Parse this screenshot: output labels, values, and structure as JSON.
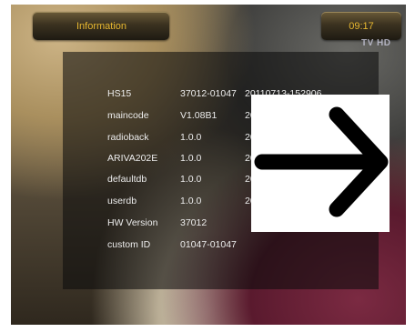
{
  "header": {
    "title": "Information",
    "time": "09:17",
    "channel_logo": "TV HD"
  },
  "info_table": {
    "rows": [
      {
        "name": "HS15",
        "version": "37012-01047",
        "date": "20110713-152906"
      },
      {
        "name": "maincode",
        "version": "V1.08B1",
        "date": "20"
      },
      {
        "name": "radioback",
        "version": "1.0.0",
        "date": "20"
      },
      {
        "name": "ARIVA202E",
        "version": "1.0.0",
        "date": "20"
      },
      {
        "name": "defaultdb",
        "version": "1.0.0",
        "date": "20"
      },
      {
        "name": "userdb",
        "version": "1.0.0",
        "date": "20"
      },
      {
        "name": "HW Version",
        "version": "37012",
        "date": ""
      },
      {
        "name": "custom ID",
        "version": "01047-01047",
        "date": ""
      }
    ]
  },
  "overlay": {
    "icon": "right-arrow-icon"
  },
  "colors": {
    "accent": "#e8b830",
    "panel": "#0c0c0c",
    "text": "#ececec"
  }
}
